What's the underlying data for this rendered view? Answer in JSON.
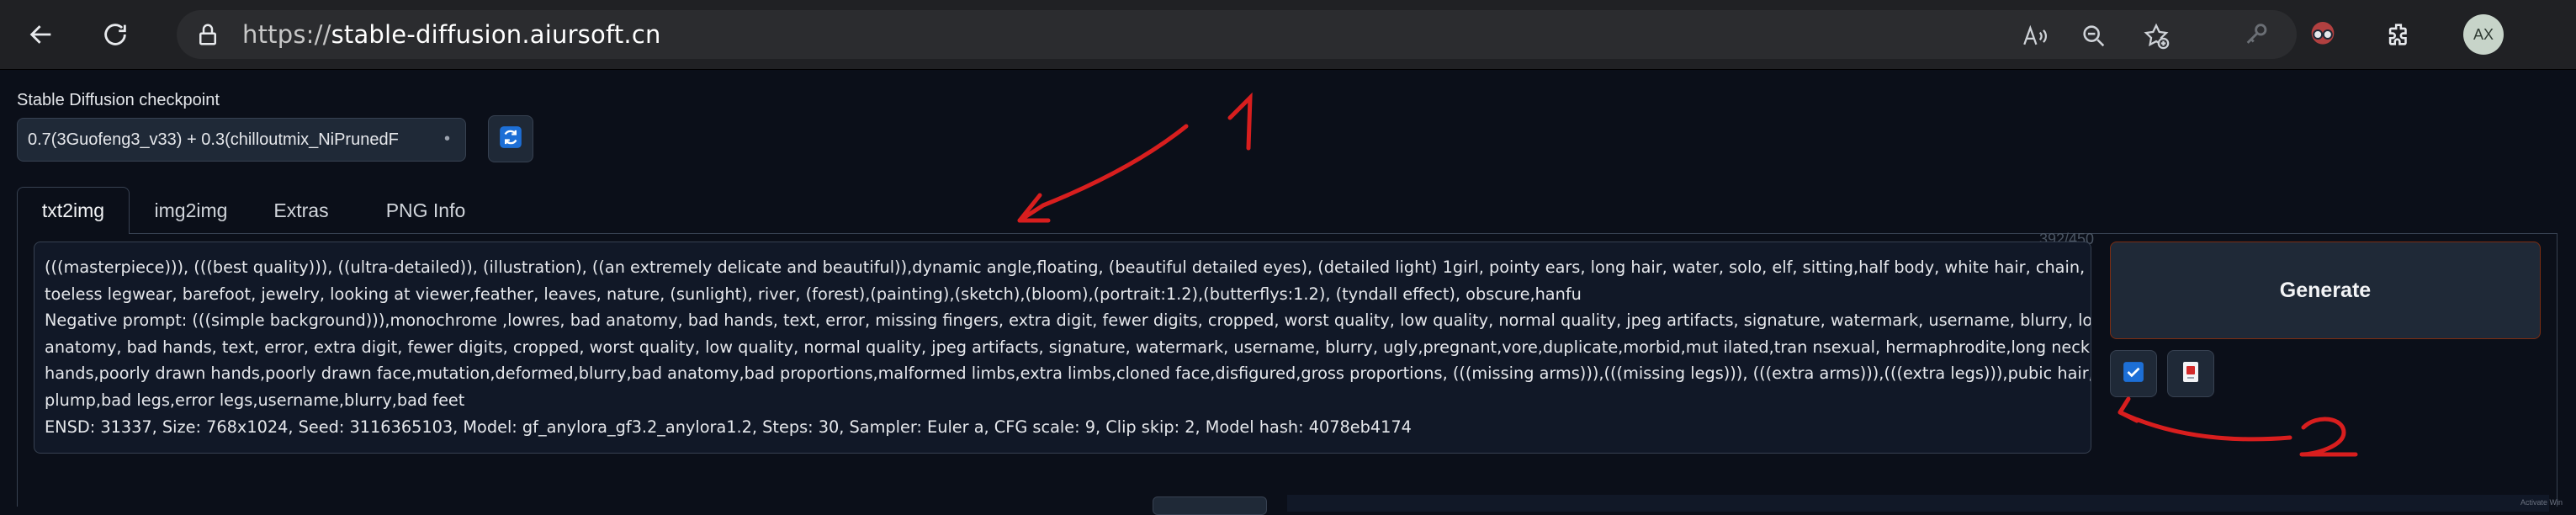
{
  "browser": {
    "url_prefix": "https://",
    "url_host": "stable-diffusion.aiursoft.cn",
    "avatar_initials": "AX",
    "icons": [
      "back-arrow-icon",
      "reload-icon",
      "lock-icon",
      "read-aloud-icon",
      "zoom-out-icon",
      "favorite-add-icon",
      "key-icon",
      "glasses-icon",
      "extensions-icon"
    ]
  },
  "checkpoint": {
    "label": "Stable Diffusion checkpoint",
    "value": "0.7(3Guofeng3_v33) + 0.3(chilloutmix_NiPrunedF",
    "refresh_icon": "refresh-icon"
  },
  "tabs": [
    {
      "label": "txt2img",
      "active": true
    },
    {
      "label": "img2img",
      "active": false
    },
    {
      "label": "Extras",
      "active": false
    },
    {
      "label": "PNG Info",
      "active": false
    }
  ],
  "prompt": {
    "token_counter": "392/450",
    "lines": [
      "(((masterpiece))), (((best quality))), ((ultra-detailed)), (illustration), ((an extremely delicate and beautiful)),dynamic angle,floating, (beautiful detailed eyes), (detailed light) 1girl, pointy ears, long hair, water, solo, elf, sitting,half body, white hair, chain, green eyes,",
      "toeless legwear, barefoot, jewelry, looking at viewer,feather, leaves, nature, (sunlight), river, (forest),(painting),(sketch),(bloom),(portrait:1.2),(butterflys:1.2), (tyndall effect), obscure,hanfu",
      "Negative prompt: (((simple background))),monochrome ,lowres, bad anatomy, bad hands, text, error, missing fingers, extra digit, fewer digits, cropped, worst quality, low quality, normal quality, jpeg artifacts, signature, watermark, username, blurry, lowres, bad",
      "anatomy, bad hands, text, error, extra digit, fewer digits, cropped, worst quality, low quality, normal quality, jpeg artifacts, signature, watermark, username, blurry, ugly,pregnant,vore,duplicate,morbid,mut ilated,tran nsexual, hermaphrodite,long neck,mutated",
      "hands,poorly drawn hands,poorly drawn face,mutation,deformed,blurry,bad anatomy,bad proportions,malformed limbs,extra limbs,cloned face,disfigured,gross proportions, (((missing arms))),(((missing legs))), (((extra arms))),(((extra legs))),pubic hair,",
      "plump,bad legs,error legs,username,blurry,bad feet",
      "ENSD: 31337, Size: 768x1024, Seed: 3116365103, Model: gf_anylora_gf3.2_anylora1.2, Steps: 30, Sampler: Euler a, CFG scale: 9, Clip skip: 2, Model hash: 4078eb4174"
    ]
  },
  "actions": {
    "generate_label": "Generate",
    "paste_icon": "checkbox-checked-icon",
    "trash_icon": "red-clear-icon"
  },
  "annotations": {
    "mark_1": "1",
    "mark_2": "2",
    "color": "#d81e1e"
  },
  "footer_watermark": "Activate Win"
}
